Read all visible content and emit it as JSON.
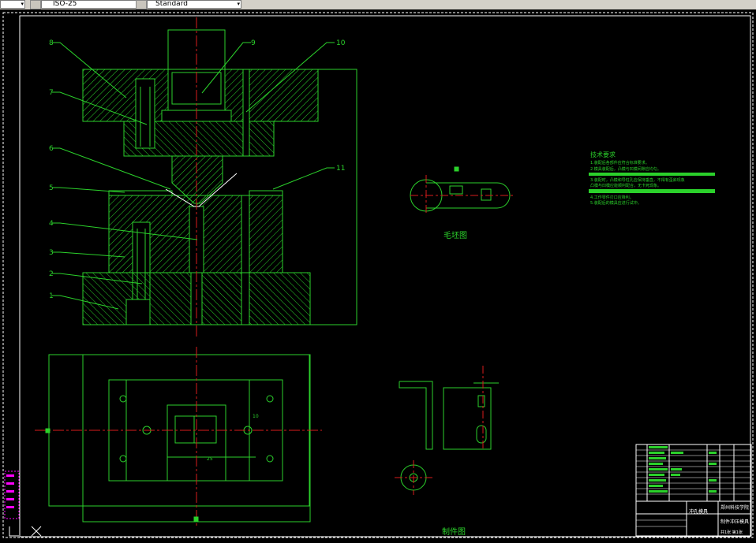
{
  "toolbar": {
    "combo_left_value": "",
    "scale_value": "ISO-25",
    "style_value": "Standard",
    "dropdown_glyph": "▾"
  },
  "drawing": {
    "part_numbers": [
      "8",
      "9",
      "10",
      "7",
      "6",
      "11",
      "5",
      "4",
      "3",
      "2",
      "1"
    ],
    "blank_caption": "毛坯图",
    "part_caption": "制件图",
    "tech_title": "技术要求",
    "tech_lines": [
      "1.装配后各部件应符合标准要求。",
      "2.模具装配后，凸模与凹模间隙应均匀。",
      "3.装配时，凸模和导柱孔应保持垂直，不得有歪斜现象",
      "  凸模与凹模应能顺利配合，无卡死现象。",
      "4.工作零件刃口应锋利。",
      "5.装配后的模具应进行试冲。"
    ],
    "dim_25": "25",
    "dim_10": "10",
    "title_block": {
      "company": "郑州科技学院",
      "drawing_name": "冲孔模具",
      "product": "制件冲压模具",
      "sheet": "共1张 第1张"
    },
    "colors": {
      "part_lines": "#2bd12b",
      "center_lines": "#d81b1b",
      "white": "#ffffff",
      "magenta": "#ff00ff"
    }
  }
}
